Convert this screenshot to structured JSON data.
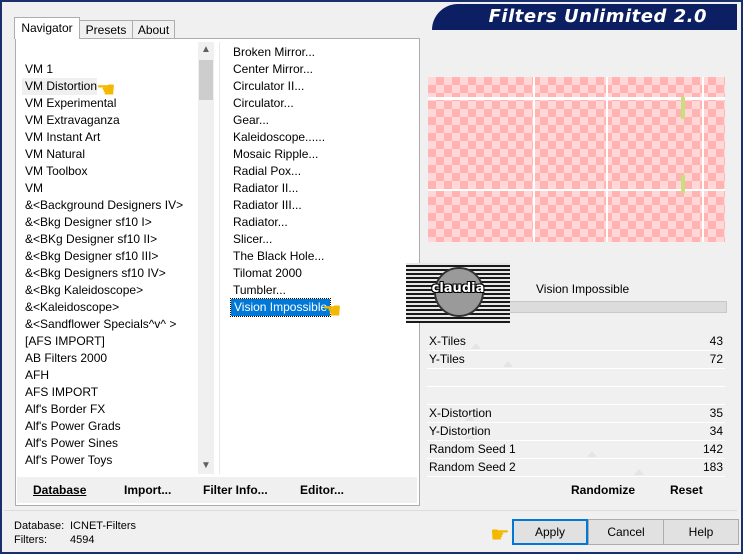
{
  "window": {
    "title": "Filters Unlimited 2.0"
  },
  "tabs": [
    "Navigator",
    "Presets",
    "About"
  ],
  "categories": [
    "VM 1",
    "VM Distortion",
    "VM Experimental",
    "VM Extravaganza",
    "VM Instant Art",
    "VM Natural",
    "VM Toolbox",
    "VM",
    "&<Background Designers IV>",
    "&<Bkg Designer sf10 I>",
    "&<BKg Designer sf10 II>",
    "&<Bkg Designer sf10 III>",
    "&<Bkg Designers sf10 IV>",
    "&<Bkg Kaleidoscope>",
    "&<Kaleidoscope>",
    "&<Sandflower Specials^v^ >",
    "[AFS IMPORT]",
    "AB Filters 2000",
    "AFH",
    "AFS IMPORT",
    "Alf's Border FX",
    "Alf's Power Grads",
    "Alf's Power Sines",
    "Alf's Power Toys"
  ],
  "selected_category": "VM Distortion",
  "filters": [
    "Broken Mirror...",
    "Center Mirror...",
    "Circulator II...",
    "Circulator...",
    "Gear...",
    "Kaleidoscope......",
    "Mosaic Ripple...",
    "Radial Pox...",
    "Radiator II...",
    "Radiator III...",
    "Radiator...",
    "Slicer...",
    "The Black Hole...",
    "Tilomat 2000",
    "Tumbler...",
    "Vision Impossible"
  ],
  "selected_filter": "Vision Impossible",
  "buttons": {
    "database": "Database",
    "import": "Import...",
    "filter_info": "Filter Info...",
    "editor": "Editor...",
    "randomize": "Randomize",
    "reset": "Reset",
    "apply": "Apply",
    "cancel": "Cancel",
    "help": "Help"
  },
  "logo_text": "claudia",
  "params": [
    {
      "label": "X-Tiles",
      "value": "43"
    },
    {
      "label": "Y-Tiles",
      "value": "72"
    },
    {
      "label": "X-Distortion",
      "value": "35"
    },
    {
      "label": "Y-Distortion",
      "value": "34"
    },
    {
      "label": "Random Seed 1",
      "value": "142"
    },
    {
      "label": "Random Seed 2",
      "value": "183"
    }
  ],
  "status": {
    "database_label": "Database:",
    "database_value": "ICNET-Filters",
    "filters_label": "Filters:",
    "filters_value": "4594"
  },
  "colors": {
    "banner": "#0d1f63",
    "selection": "#0078d7",
    "pointer": "#f5b800"
  }
}
